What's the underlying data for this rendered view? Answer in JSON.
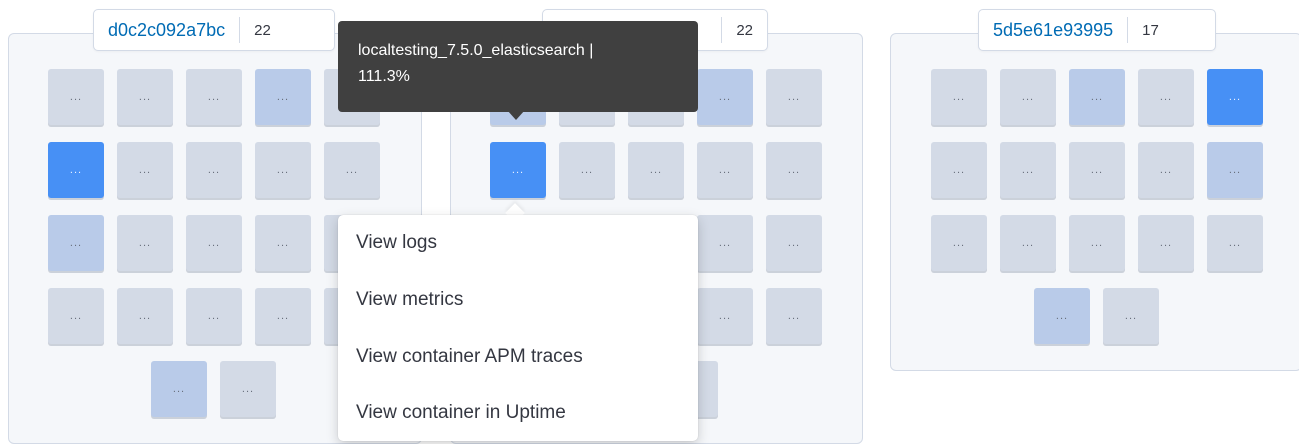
{
  "groups": [
    {
      "title": "d0c2c092a7bc",
      "count": "22"
    },
    {
      "title": "",
      "count": "22"
    },
    {
      "title": "5d5e61e93995",
      "count": "17"
    }
  ],
  "node_label": "...",
  "tooltip": {
    "name": "localtesting_7.5.0_elasticsearch |",
    "value": "111.3%"
  },
  "menu": {
    "items": [
      "View logs",
      "View metrics",
      "View container APM traces",
      "View container in Uptime"
    ]
  },
  "colors": {
    "node_idle": "#d3dae6",
    "node_low": "#b9cbe9",
    "node_high": "#4790f5",
    "title_link": "#006bb4",
    "tooltip_bg": "#404040"
  }
}
